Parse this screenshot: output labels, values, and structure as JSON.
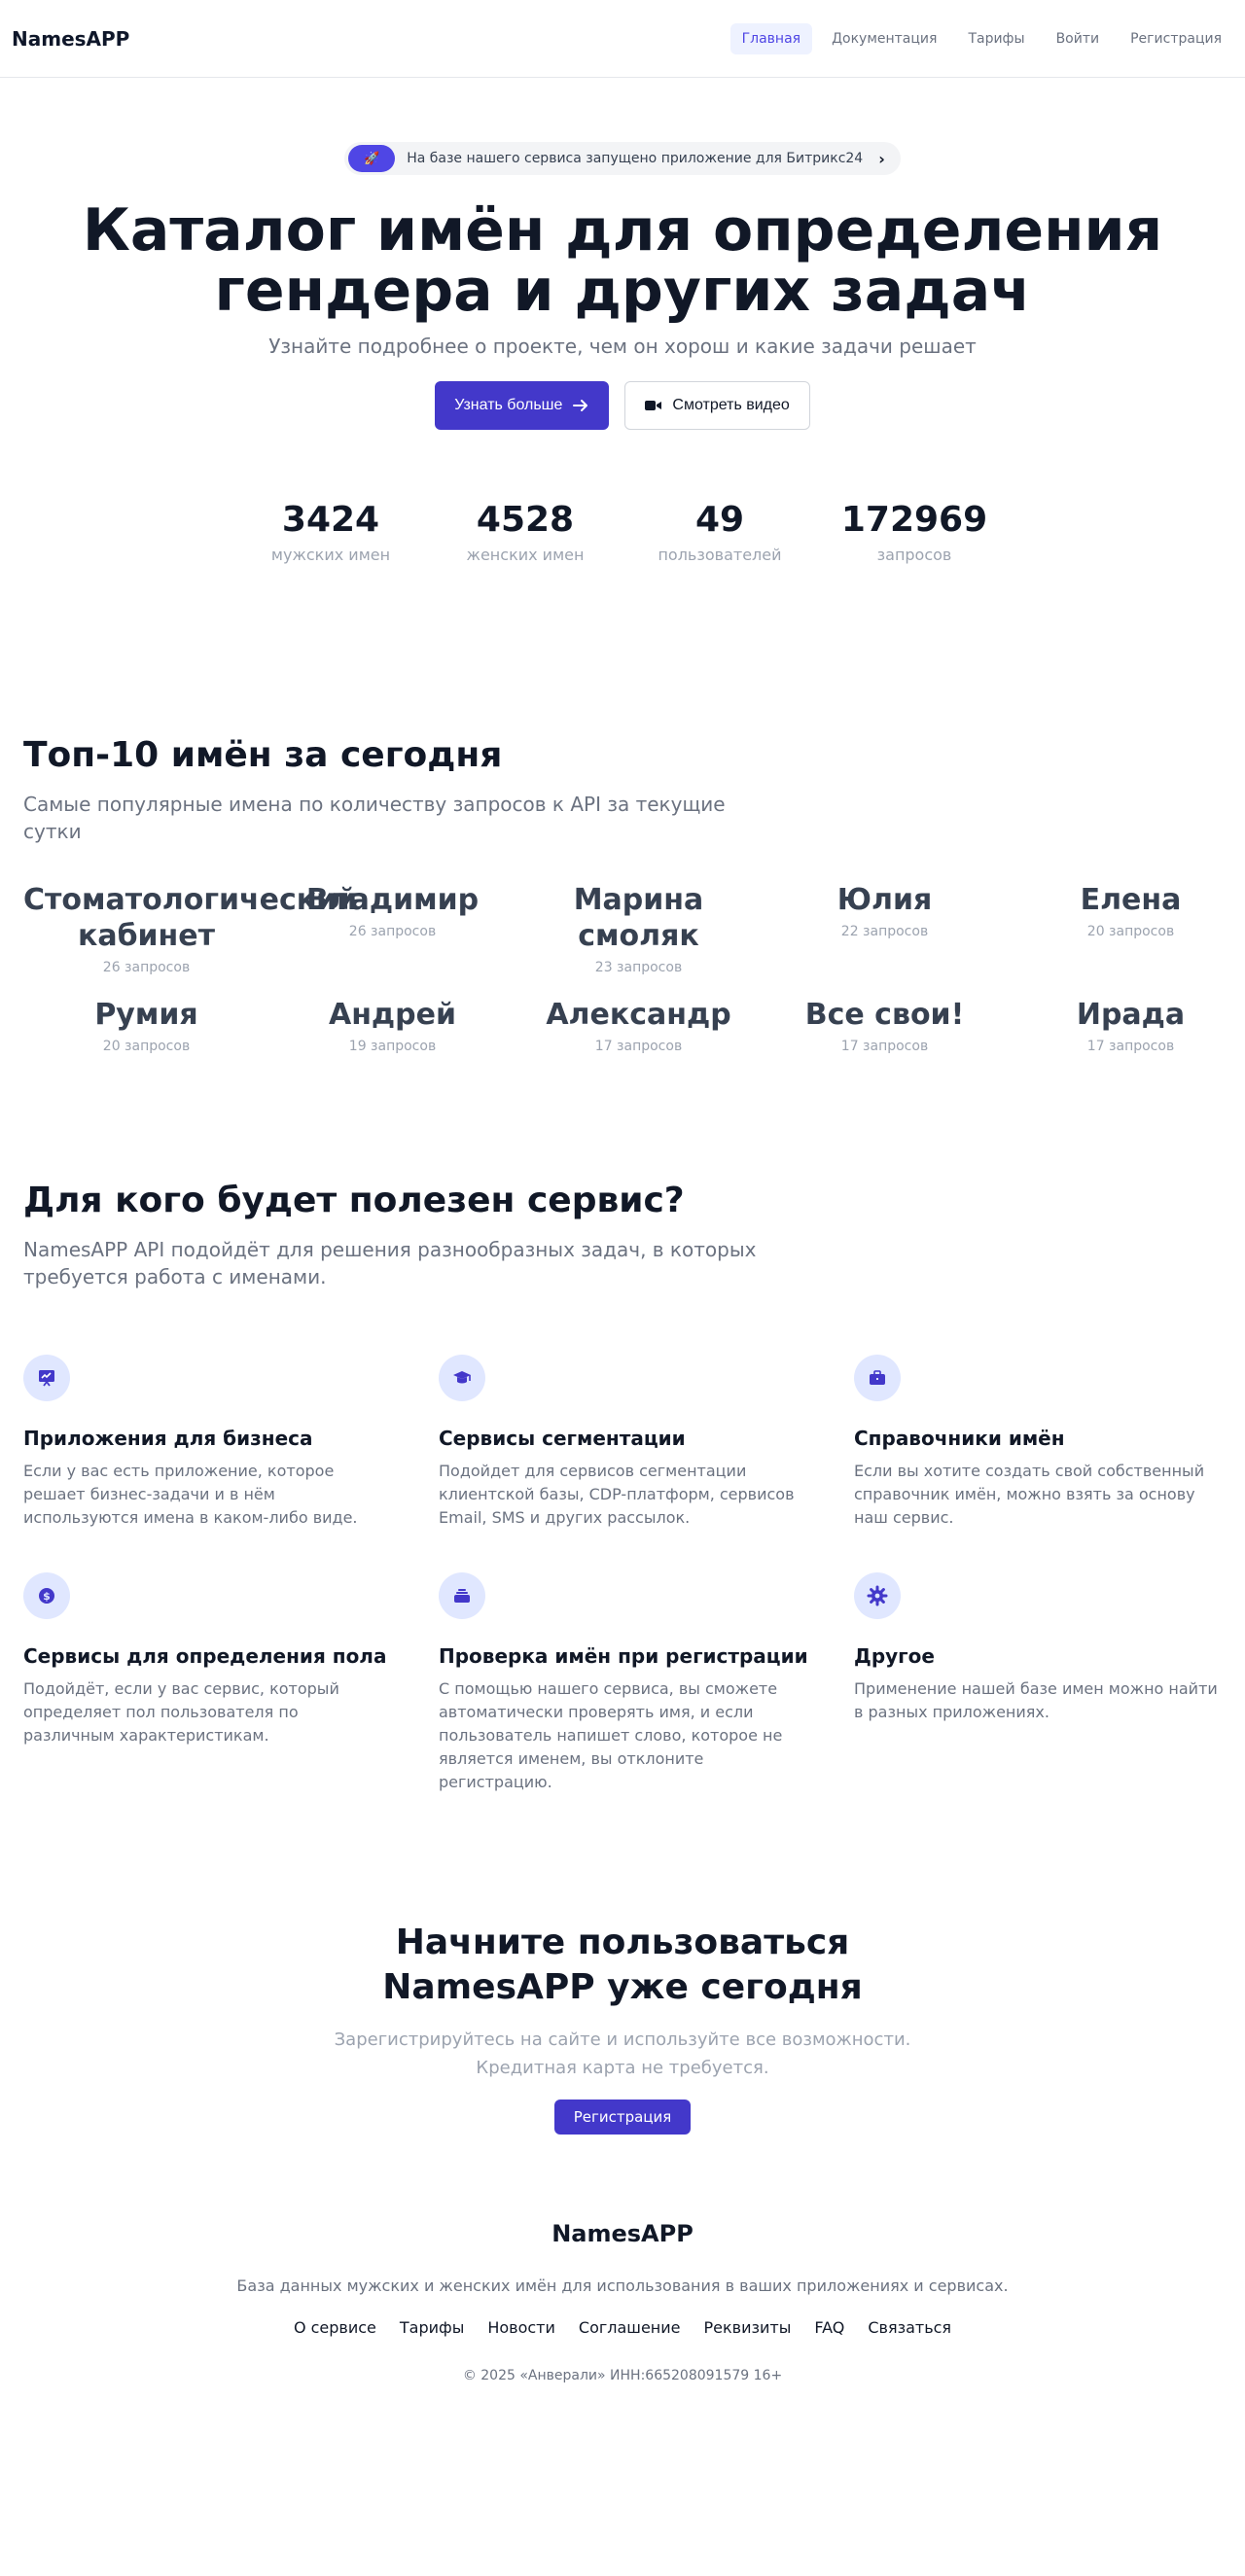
{
  "nav": {
    "brand": "NamesAPP",
    "links": [
      {
        "label": "Главная",
        "active": true
      },
      {
        "label": "Документация"
      },
      {
        "label": "Тарифы"
      },
      {
        "label": "Войти"
      },
      {
        "label": "Регистрация"
      }
    ]
  },
  "hero": {
    "announce_icon": "rocket-icon",
    "announce_pill": "🚀",
    "announce_text": "На базе нашего сервиса запущено приложение для Битрикс24",
    "title": "Каталог имён для определения гендера и других задач",
    "subtitle": "Узнайте подробнее о проекте, чем он хорош и какие задачи решает",
    "primary_button": "Узнать больше",
    "secondary_button": "Смотреть видео"
  },
  "stats": [
    {
      "value": "3424",
      "label": "мужских имен"
    },
    {
      "value": "4528",
      "label": "женских имен"
    },
    {
      "value": "49",
      "label": "пользователей"
    },
    {
      "value": "172969",
      "label": "запросов"
    }
  ],
  "top": {
    "title": "Топ-10 имён за сегодня",
    "subtitle": "Самые популярные имена по количеству запросов к API за текущие сутки",
    "names": [
      {
        "name": "Стоматологический кабинет",
        "count": "26 запросов"
      },
      {
        "name": "Владимир",
        "count": "26 запросов"
      },
      {
        "name": "Марина смоляк",
        "count": "23 запросов"
      },
      {
        "name": "Юлия",
        "count": "22 запросов"
      },
      {
        "name": "Елена",
        "count": "20 запросов"
      },
      {
        "name": "Румия",
        "count": "20 запросов"
      },
      {
        "name": "Андрей",
        "count": "19 запросов"
      },
      {
        "name": "Александр",
        "count": "17 запросов"
      },
      {
        "name": "Все свои!",
        "count": "17 запросов"
      },
      {
        "name": "Ирада",
        "count": "17 запросов"
      }
    ]
  },
  "features": {
    "title": "Для кого будет полезен сервис?",
    "subtitle": "NamesAPP API подойдёт для решения разнообразных задач, в которых требуется работа с именами.",
    "items": [
      {
        "icon": "presentation-chart-icon",
        "title": "Приложения для бизнеса",
        "desc": "Если у вас есть приложение, которое решает бизнес-задачи и в нём используются имена в каком-либо виде."
      },
      {
        "icon": "graduation-cap-icon",
        "title": "Сервисы сегментации",
        "desc": "Подойдет для сервисов сегментации клиентской базы, CDP-платформ, сервисов Email, SMS и других рассылок."
      },
      {
        "icon": "briefcase-icon",
        "title": "Справочники имён",
        "desc": "Если вы хотите создать свой собственный справочник имён, можно взять за основу наш сервис."
      },
      {
        "icon": "dollar-circle-icon",
        "title": "Сервисы для определения пола",
        "desc": "Подойдёт, если у вас сервис, который определяет пол пользователя по различным характеристикам."
      },
      {
        "icon": "inbox-stack-icon",
        "title": "Проверка имён при регистрации",
        "desc": "С помощью нашего сервиса, вы сможете автоматически проверять имя, и если пользователь напишет слово, которое не является именем, вы отклоните регистрацию."
      },
      {
        "icon": "gear-icon",
        "title": "Другое",
        "desc": "Применение нашей базе имен можно найти в разных приложениях."
      }
    ]
  },
  "cta": {
    "title": "Начните пользоваться NamesAPP уже сегодня",
    "subtitle": "Зарегистрируйтесь на сайте и используйте все возможности. Кредитная карта не требуется.",
    "button": "Регистрация"
  },
  "footer": {
    "brand": "NamesAPP",
    "desc": "База данных мужских и женских имён для использования в ваших приложениях и сервисах.",
    "links": [
      "О сервисе",
      "Тарифы",
      "Новости",
      "Соглашение",
      "Реквизиты",
      "FAQ",
      "Связаться"
    ],
    "copyright": "© 2025 «Анверали» ИНН:665208091579 16+"
  },
  "colors": {
    "accent": "#4338ca",
    "accent_light": "#e0e7ff",
    "text_dark": "#111827",
    "text_muted": "#6b7280"
  }
}
